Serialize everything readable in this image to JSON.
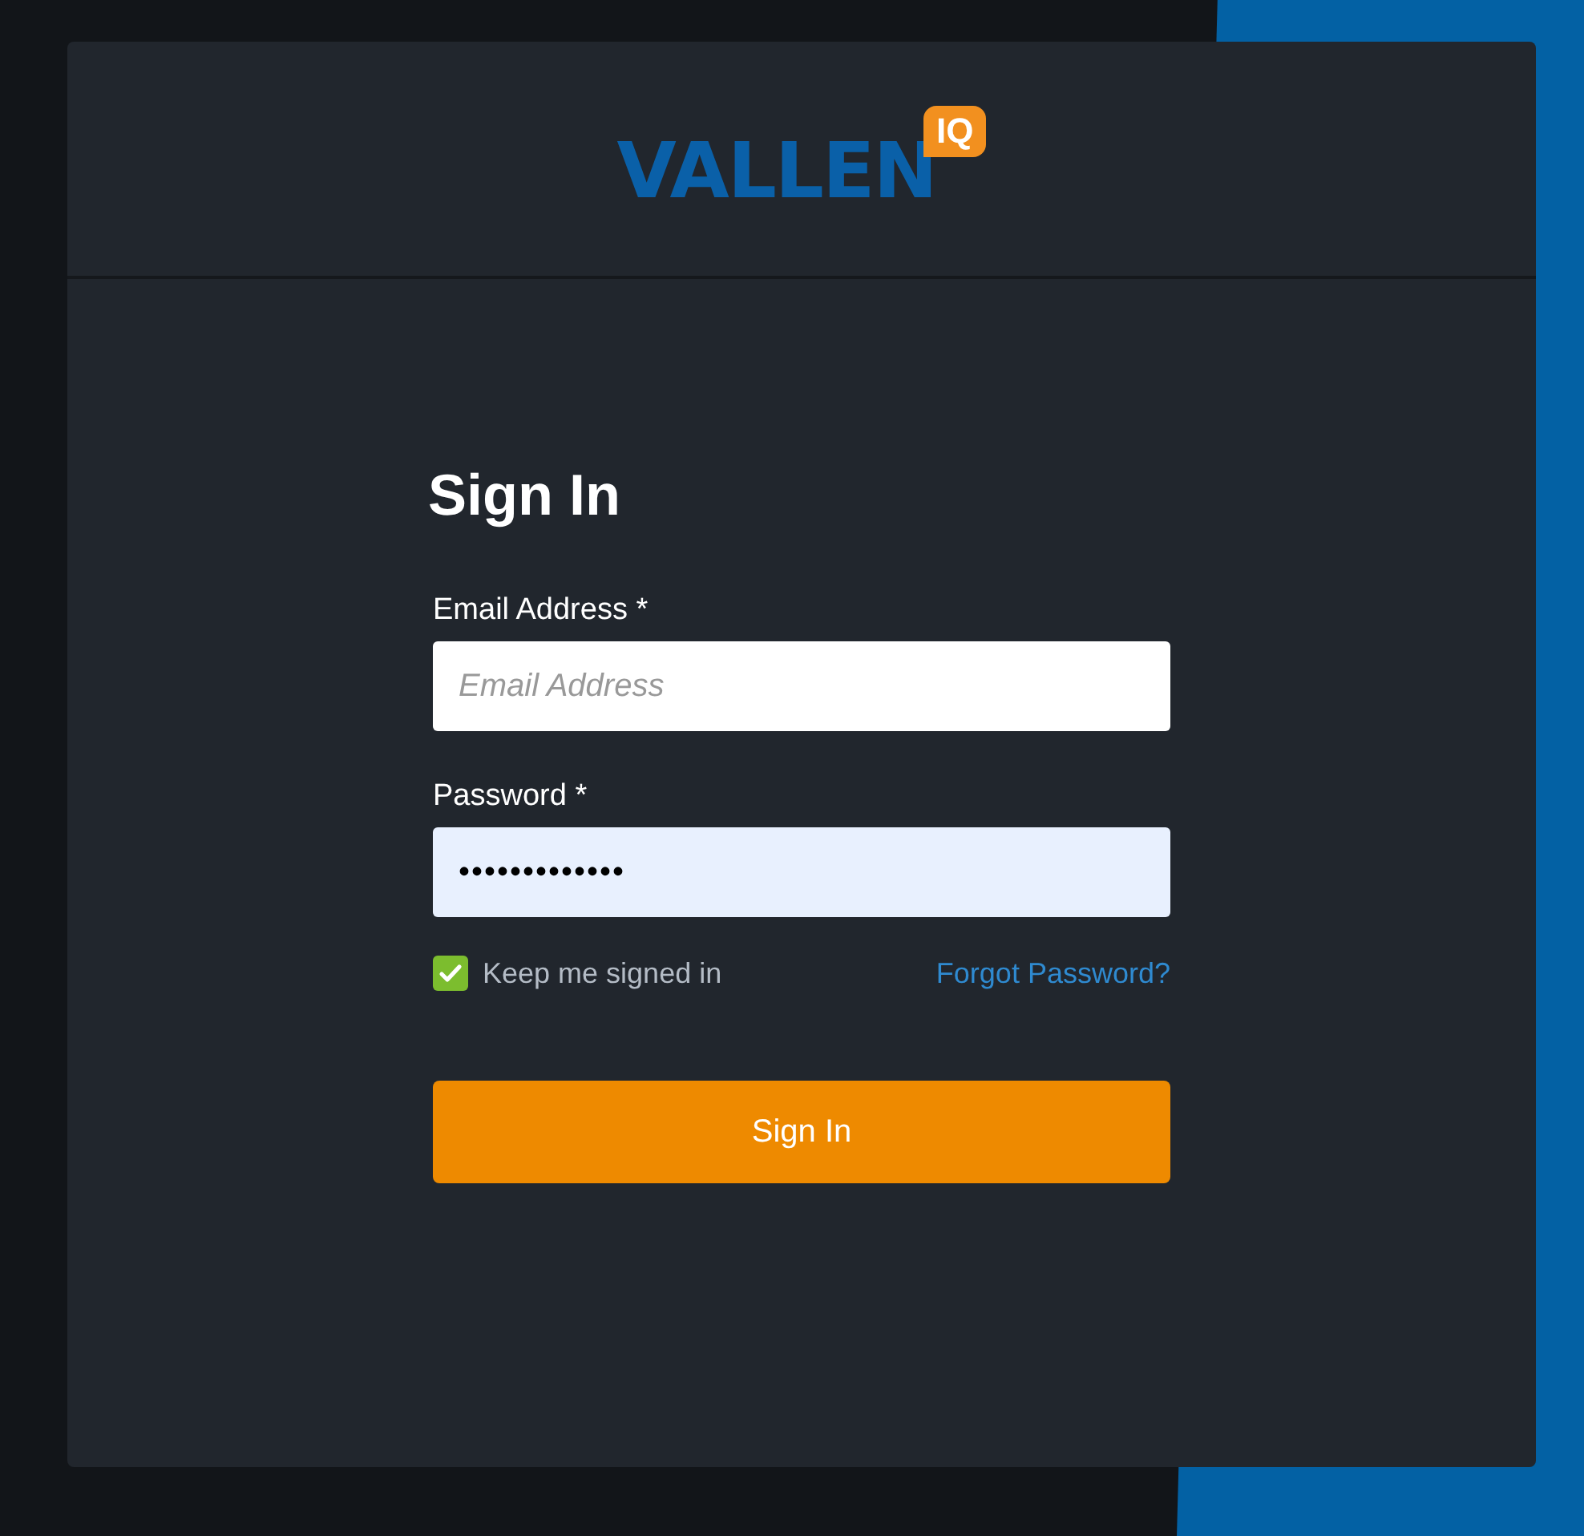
{
  "logo": {
    "word": "VALLEN",
    "badge": "IQ"
  },
  "title": "Sign In",
  "fields": [
    {
      "label": "Email Address *",
      "placeholder": "Email Address",
      "autofilled": false
    },
    {
      "label": "Password *",
      "value": "•••••••••••••",
      "autofilled": true
    }
  ],
  "remember": {
    "label": "Keep me signed in",
    "checked": true
  },
  "forgot_link": "Forgot Password?",
  "submit": "Sign In"
}
